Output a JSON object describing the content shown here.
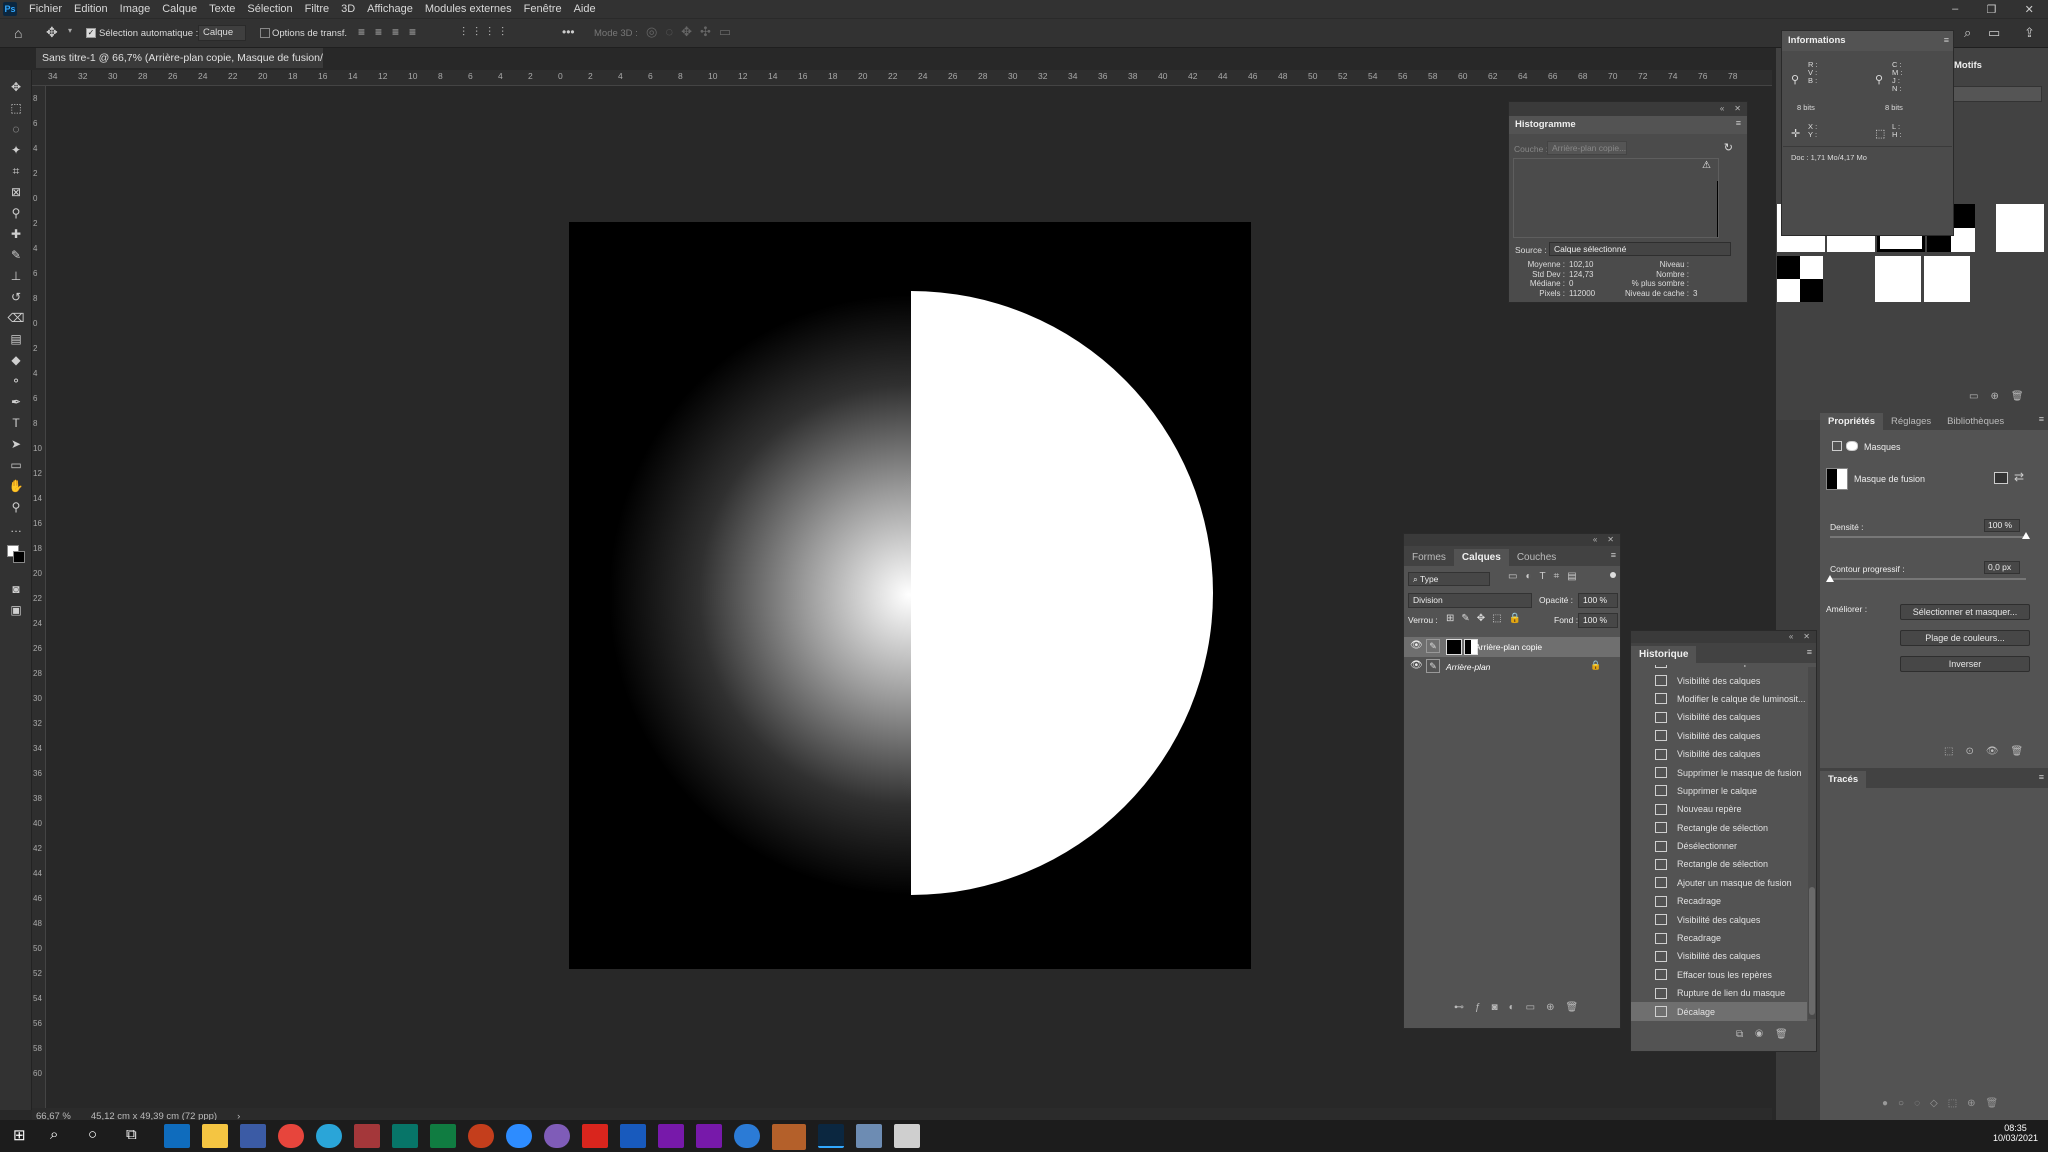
{
  "app": {
    "logo": "Ps"
  },
  "menu": [
    "Fichier",
    "Edition",
    "Image",
    "Calque",
    "Texte",
    "Sélection",
    "Filtre",
    "3D",
    "Affichage",
    "Modules externes",
    "Fenêtre",
    "Aide"
  ],
  "options": {
    "auto_select_label": "Sélection automatique :",
    "auto_select_value": "Calque",
    "transform_label": "Options de transf.",
    "mode3d_label": "Mode 3D :",
    "more": "•••"
  },
  "document": {
    "tab_title": "Sans titre-1 @ 66,7% (Arrière-plan copie, Masque de fusion/8) *"
  },
  "rulers": {
    "h_ticks": [
      "34",
      "32",
      "30",
      "28",
      "26",
      "24",
      "22",
      "20",
      "18",
      "16",
      "14",
      "12",
      "10",
      "8",
      "6",
      "4",
      "2",
      "0",
      "2",
      "4",
      "6",
      "8",
      "10",
      "12",
      "14",
      "16",
      "18",
      "20",
      "22",
      "24",
      "26",
      "28",
      "30",
      "32",
      "34",
      "36",
      "38",
      "40",
      "42",
      "44",
      "46",
      "48",
      "50",
      "52",
      "54",
      "56",
      "58",
      "60",
      "62",
      "64",
      "66",
      "68",
      "70",
      "72",
      "74",
      "76",
      "78"
    ],
    "v_ticks": [
      "8",
      "6",
      "4",
      "2",
      "0",
      "2",
      "4",
      "6",
      "8",
      "0",
      "2",
      "4",
      "6",
      "8",
      "10",
      "12",
      "14",
      "16",
      "18",
      "20",
      "22",
      "24",
      "26",
      "28",
      "30",
      "32",
      "34",
      "36",
      "38",
      "40",
      "42",
      "44",
      "46",
      "48",
      "50",
      "52",
      "54",
      "56",
      "58",
      "60"
    ]
  },
  "status": {
    "zoom": "66,67 %",
    "size": "45,12 cm x 49,39 cm (72 ppp)",
    "arrow": "›"
  },
  "histogram": {
    "title": "Histogramme",
    "couche_label": "Couche :",
    "couche_value": "Arrière-plan copie...",
    "source_label": "Source :",
    "source_value": "Calque sélectionné",
    "stats_left_labels": [
      "Moyenne :",
      "Std Dev :",
      "Médiane :",
      "Pixels :"
    ],
    "stats_left_values": [
      "102,10",
      "124,73",
      "0",
      "112000"
    ],
    "stats_right_labels": [
      "Niveau :",
      "Nombre :",
      "% plus sombre :",
      "Niveau de cache :"
    ],
    "stats_right_values": [
      "",
      "",
      "",
      "3"
    ]
  },
  "info": {
    "title": "Informations",
    "row1_left": [
      "R :",
      "V :",
      "B :"
    ],
    "row1_right": [
      "C :",
      "M :",
      "J :",
      "N :"
    ],
    "bits_left": "8 bits",
    "bits_right": "8 bits",
    "row2_left": [
      "X :",
      "Y :"
    ],
    "row2_right": [
      "L :",
      "H :"
    ],
    "doc": "Doc : 1,71 Mo/4,17 Mo"
  },
  "motifs": {
    "title": "Motifs"
  },
  "layers": {
    "tabs": [
      "Formes",
      "Calques",
      "Couches"
    ],
    "filter_label": "Type",
    "blend_mode": "Division",
    "opacity_label": "Opacité :",
    "opacity_value": "100 %",
    "lock_label": "Verrou :",
    "fill_label": "Fond :",
    "fill_value": "100 %",
    "items": [
      {
        "name": "Arrière-plan copie"
      },
      {
        "name": "Arrière-plan"
      }
    ]
  },
  "history": {
    "title": "Historique",
    "items": [
      "Visibilité des calques",
      "Visibilité des calques",
      "Modifier le calque de luminosit...",
      "Visibilité des calques",
      "Visibilité des calques",
      "Visibilité des calques",
      "Supprimer le masque de fusion",
      "Supprimer le calque",
      "Nouveau repère",
      "Rectangle de sélection",
      "Désélectionner",
      "Rectangle de sélection",
      "Ajouter un masque de fusion",
      "Recadrage",
      "Visibilité des calques",
      "Recadrage",
      "Visibilité des calques",
      "Effacer tous les repères",
      "Rupture de lien du masque",
      "Décalage"
    ]
  },
  "properties": {
    "tabs": [
      "Propriétés",
      "Réglages",
      "Bibliothèques"
    ],
    "section": "Masques",
    "mask_name": "Masque de fusion",
    "density_label": "Densité :",
    "density_value": "100 %",
    "density_fraction": 1.0,
    "feather_label": "Contour progressif :",
    "feather_value": "0,0 px",
    "feather_fraction": 0.0,
    "refine_label": "Améliorer :",
    "btn_select_mask": "Sélectionner et masquer...",
    "btn_color_range": "Plage de couleurs...",
    "btn_invert": "Inverser"
  },
  "traces": {
    "title": "Tracés"
  },
  "taskbar": {
    "time": "08:35",
    "date": "10/03/2021"
  }
}
